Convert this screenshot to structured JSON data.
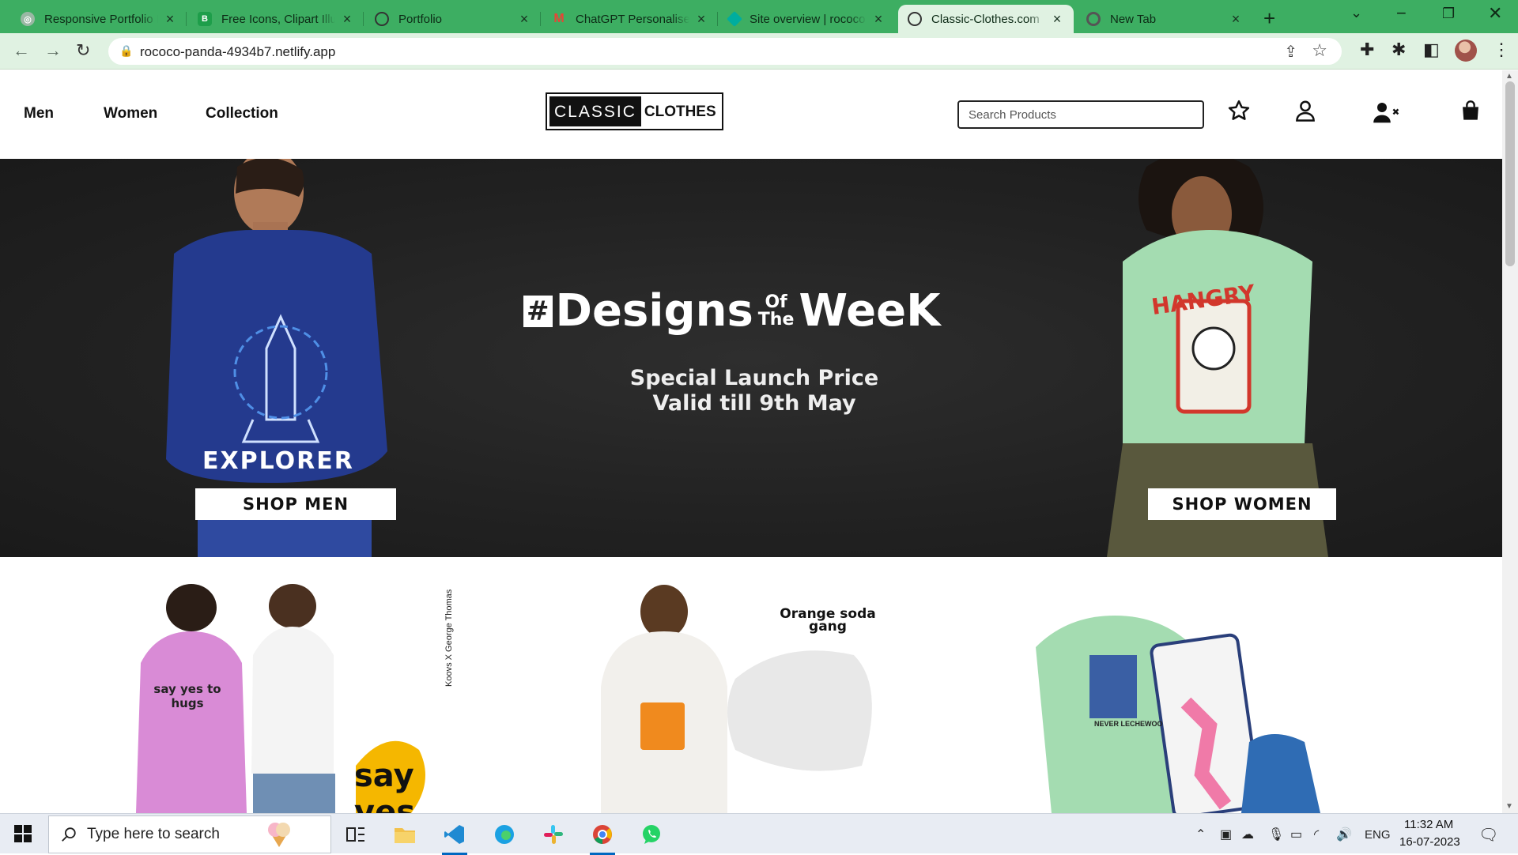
{
  "browser": {
    "tabs": [
      {
        "title": "Responsive Portfolio Developer",
        "favicon_color": "#6b8f7a",
        "active": false
      },
      {
        "title": "Free Icons, Clipart Illustrations",
        "favicon_color": "#1e9e4a",
        "active": false
      },
      {
        "title": "Portfolio",
        "favicon_color": "#444444",
        "active": false
      },
      {
        "title": "ChatGPT Personalised",
        "favicon_color": "#ea4335",
        "active": false
      },
      {
        "title": "Site overview | rococo",
        "favicon_color": "#00ad9f",
        "active": false
      },
      {
        "title": "Classic-Clothes.com",
        "favicon_color": "#444444",
        "active": true
      },
      {
        "title": "New Tab",
        "favicon_color": "#555555",
        "active": false
      }
    ],
    "url": "rococo-panda-4934b7.netlify.app"
  },
  "site": {
    "nav": [
      "Men",
      "Women",
      "Collection"
    ],
    "logo": {
      "part1": "CLASSIC",
      "part2": "CLOTHES"
    },
    "search_placeholder": "Search Products"
  },
  "hero": {
    "hash": "#",
    "title_a": "Designs",
    "title_of": "Of",
    "title_the": "The",
    "title_b": "WeeK",
    "subtitle_line1": "Special Launch Price",
    "subtitle_line2": "Valid till 9th May",
    "men_shirt_text": "EXPLORER",
    "women_shirt_text": "HANGRY",
    "shop_men": "SHOP MEN",
    "shop_women": "SHOP WOMEN"
  },
  "collections": [
    {
      "graphic_text_1": "say yes to hugs",
      "side_text": "Koovs X George Thomas",
      "big_text": "say yes"
    },
    {
      "graphic_text_1": "Orange soda gang"
    },
    {
      "graphic_text_1": "NEVER LECHEWOO"
    }
  ],
  "taskbar": {
    "search_placeholder": "Type here to search",
    "lang": "ENG",
    "time": "11:32 AM",
    "date": "16-07-2023"
  }
}
